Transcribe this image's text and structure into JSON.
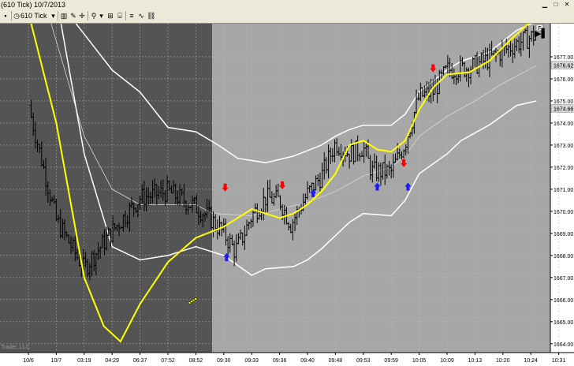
{
  "window": {
    "title": "(610 Tick)  10/7/2013"
  },
  "toolbar": {
    "interval_label": "610 Tick",
    "dropdown_glyph": "▾",
    "buttons": [
      "bar-type-icon",
      "pencil-icon",
      "crosshair-icon",
      "zoom-icon",
      "data-box-icon",
      "properties-icon",
      "strategy-icon",
      "indicator-icon",
      "link-icon"
    ]
  },
  "chart_buttons": {
    "play_glyph": "▶▌",
    "f_label": "F"
  },
  "watermark": "Trader, LLC",
  "colors": {
    "background_historical": "#545454",
    "background_live": "#a7a7a7",
    "grid": "#bdbdbd",
    "moving_average": "#ffff00",
    "band_upper_lower": "#ffffff",
    "band_mid": "#d8d8d8",
    "bars": "#000000",
    "sell_arrow": "#ff0000",
    "buy_arrow": "#1a1aff",
    "price_marker": "#d6d6d6"
  },
  "chart_data": {
    "type": "candlestick",
    "ylim": [
      1663.6,
      1678.5
    ],
    "y_ticks": [
      "1677.00",
      "1676.00",
      "1675.00",
      "1674.00",
      "1673.00",
      "1672.00",
      "1671.00",
      "1670.00",
      "1669.00",
      "1668.00",
      "1667.00",
      "1666.00",
      "1665.00",
      "1664.00"
    ],
    "price_markers": [
      "1676.62",
      "1674.66"
    ],
    "x_ticks": [
      "10/6",
      "10/7",
      "03:19",
      "04:29",
      "06:37",
      "07:52",
      "08:52",
      "09:30",
      "09:33",
      "09:36",
      "09:40",
      "09:48",
      "09:53",
      "09:59",
      "10:05",
      "10:09",
      "10:13",
      "10:20",
      "10:24",
      "10:31"
    ],
    "session_split_index": 6.5,
    "close_path": [
      [
        0,
        1674.8
      ],
      [
        1,
        1669.6
      ],
      [
        2,
        1667.4
      ],
      [
        3,
        1669.1
      ],
      [
        4,
        1670.6
      ],
      [
        5,
        1670.9
      ],
      [
        6,
        1670.2
      ],
      [
        6.5,
        1669.7
      ],
      [
        7,
        1669.0
      ],
      [
        7.4,
        1668.2
      ],
      [
        7.7,
        1668.9
      ],
      [
        8,
        1669.8
      ],
      [
        8.5,
        1670.6
      ],
      [
        9,
        1670.5
      ],
      [
        9.4,
        1669.4
      ],
      [
        10,
        1670.8
      ],
      [
        10.5,
        1671.6
      ],
      [
        11,
        1673.1
      ],
      [
        11.5,
        1672.6
      ],
      [
        12,
        1672.9
      ],
      [
        12.3,
        1671.8
      ],
      [
        13,
        1671.8
      ],
      [
        13.5,
        1673.1
      ],
      [
        14,
        1675.2
      ],
      [
        14.5,
        1675.4
      ],
      [
        15,
        1676.4
      ],
      [
        15.8,
        1676.5
      ],
      [
        16.5,
        1676.9
      ],
      [
        17.5,
        1677.6
      ],
      [
        18.2,
        1678.0
      ]
    ],
    "moving_average": [
      [
        0,
        1679.0
      ],
      [
        1,
        1674.0
      ],
      [
        2,
        1667.0
      ],
      [
        2.7,
        1664.8
      ],
      [
        3.3,
        1664.1
      ],
      [
        4,
        1665.8
      ],
      [
        5,
        1667.7
      ],
      [
        6,
        1668.8
      ],
      [
        7,
        1669.3
      ],
      [
        7.5,
        1669.7
      ],
      [
        8,
        1670.1
      ],
      [
        8.5,
        1669.9
      ],
      [
        9,
        1669.7
      ],
      [
        9.5,
        1669.9
      ],
      [
        10,
        1670.3
      ],
      [
        10.5,
        1670.9
      ],
      [
        11,
        1671.7
      ],
      [
        11.5,
        1673.0
      ],
      [
        12,
        1673.2
      ],
      [
        12.5,
        1672.8
      ],
      [
        13,
        1672.7
      ],
      [
        13.5,
        1673.2
      ],
      [
        14,
        1674.6
      ],
      [
        14.5,
        1675.6
      ],
      [
        15,
        1676.2
      ],
      [
        15.8,
        1676.3
      ],
      [
        16.5,
        1676.8
      ],
      [
        17.3,
        1677.8
      ],
      [
        18,
        1678.6
      ]
    ],
    "upper_band": [
      [
        1.4,
        1679.0
      ],
      [
        3,
        1676.4
      ],
      [
        4,
        1675.4
      ],
      [
        5,
        1673.8
      ],
      [
        6,
        1673.6
      ],
      [
        6.8,
        1673.0
      ],
      [
        7.5,
        1672.4
      ],
      [
        8.5,
        1672.2
      ],
      [
        9.5,
        1672.5
      ],
      [
        10.5,
        1673.0
      ],
      [
        11,
        1673.4
      ],
      [
        11.5,
        1673.7
      ],
      [
        12,
        1673.9
      ],
      [
        13,
        1673.9
      ],
      [
        13.5,
        1674.4
      ],
      [
        14,
        1675.4
      ],
      [
        15,
        1676.4
      ],
      [
        15.5,
        1676.8
      ],
      [
        16.5,
        1677.2
      ],
      [
        17.5,
        1678.2
      ],
      [
        18.2,
        1678.6
      ]
    ],
    "lower_band": [
      [
        1.1,
        1679.0
      ],
      [
        2,
        1672.6
      ],
      [
        3,
        1668.4
      ],
      [
        4,
        1667.8
      ],
      [
        5,
        1668.0
      ],
      [
        6,
        1668.4
      ],
      [
        7,
        1668.0
      ],
      [
        8,
        1667.1
      ],
      [
        8.5,
        1667.4
      ],
      [
        9.5,
        1667.5
      ],
      [
        10,
        1667.8
      ],
      [
        10.5,
        1668.3
      ],
      [
        11,
        1668.9
      ],
      [
        11.5,
        1669.5
      ],
      [
        12,
        1669.9
      ],
      [
        13,
        1669.8
      ],
      [
        13.5,
        1670.5
      ],
      [
        14,
        1671.7
      ],
      [
        15,
        1672.6
      ],
      [
        15.5,
        1673.2
      ],
      [
        16.5,
        1673.9
      ],
      [
        17.5,
        1674.8
      ],
      [
        18.2,
        1675.0
      ]
    ],
    "mid_band": [
      [
        0.7,
        1679.0
      ],
      [
        2,
        1673.4
      ],
      [
        3,
        1671.0
      ],
      [
        4,
        1670.3
      ],
      [
        5,
        1670.3
      ],
      [
        6,
        1670.3
      ],
      [
        6.6,
        1669.9
      ],
      [
        8,
        1669.8
      ],
      [
        9,
        1670.1
      ],
      [
        10,
        1670.4
      ],
      [
        11,
        1670.9
      ],
      [
        12,
        1671.6
      ],
      [
        13,
        1672.0
      ],
      [
        13.5,
        1672.5
      ],
      [
        14,
        1673.4
      ],
      [
        15,
        1674.3
      ],
      [
        16,
        1675.0
      ],
      [
        17,
        1675.8
      ],
      [
        18.2,
        1676.6
      ]
    ],
    "sell_signals": [
      [
        7.05,
        1670.9
      ],
      [
        9.1,
        1671.0
      ],
      [
        13.45,
        1672.0
      ],
      [
        14.5,
        1676.3
      ]
    ],
    "buy_signals": [
      [
        7.1,
        1668.1
      ],
      [
        10.2,
        1671.0
      ],
      [
        12.5,
        1671.3
      ],
      [
        13.6,
        1671.3
      ]
    ],
    "alert_markers": [
      [
        5.85,
        1665.9
      ]
    ]
  }
}
